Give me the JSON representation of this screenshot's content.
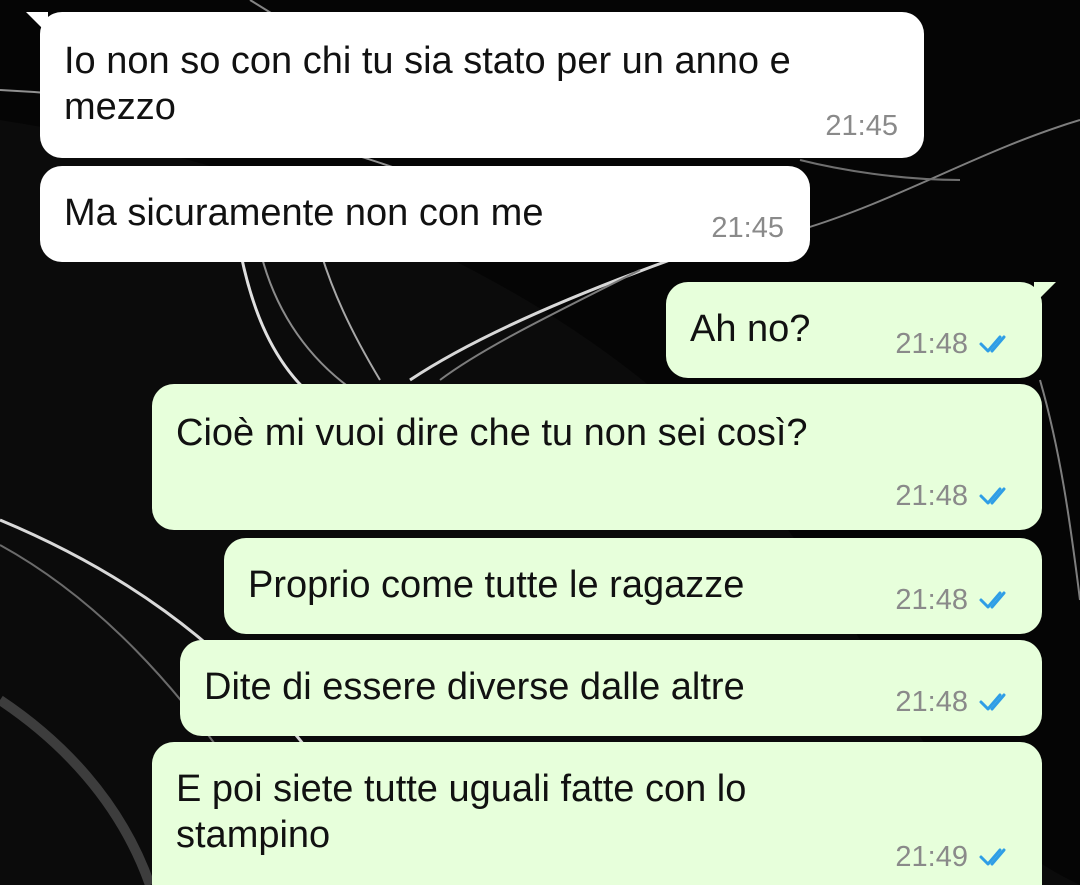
{
  "conversation": {
    "messages": [
      {
        "direction": "incoming",
        "text": "Io non so con chi tu sia stato per un anno e\nmezzo",
        "time": "21:45"
      },
      {
        "direction": "incoming",
        "text": "Ma sicuramente non con me",
        "time": "21:45"
      },
      {
        "direction": "outgoing",
        "text": "Ah no?",
        "time": "21:48",
        "status_icon": "double-check-read-icon"
      },
      {
        "direction": "outgoing",
        "text": "Cioè mi vuoi dire che tu non sei così?",
        "time": "21:48",
        "status_icon": "double-check-read-icon"
      },
      {
        "direction": "outgoing",
        "text": "Proprio come tutte le ragazze",
        "time": "21:48",
        "status_icon": "double-check-read-icon"
      },
      {
        "direction": "outgoing",
        "text": "Dite di essere diverse dalle altre",
        "time": "21:48",
        "status_icon": "double-check-read-icon"
      },
      {
        "direction": "outgoing",
        "text": "E poi siete tutte uguali fatte con lo\nstampino",
        "time": "21:49",
        "status_icon": "double-check-read-icon"
      }
    ]
  },
  "colors": {
    "incoming_bubble": "#ffffff",
    "outgoing_bubble": "#e7ffdb",
    "read_ticks": "#2f9ee6",
    "wallpaper": "#050505"
  }
}
